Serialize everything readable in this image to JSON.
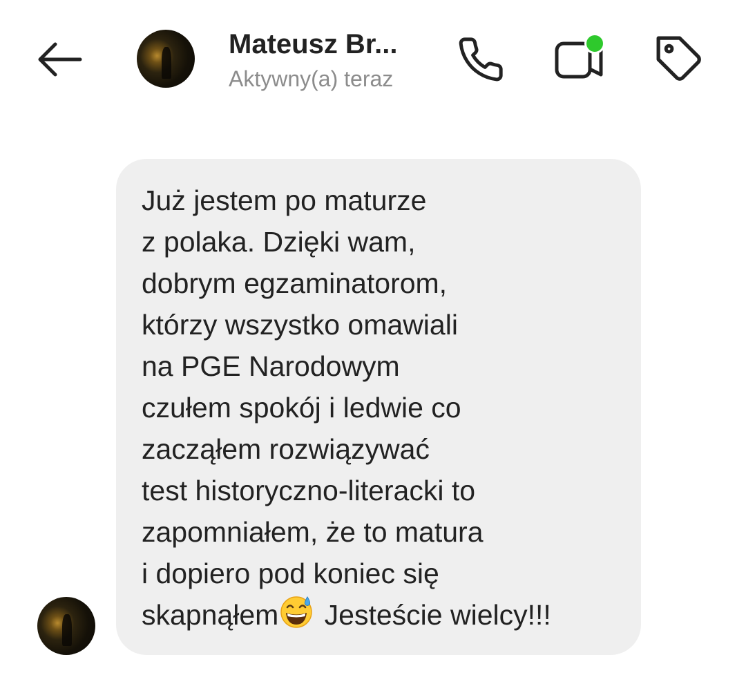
{
  "header": {
    "back_icon": "arrow-left-icon",
    "contact_name": "Mateusz Br...",
    "status": "Aktywny(a) teraz",
    "call_icon": "phone-icon",
    "video_icon": "video-camera-icon",
    "tag_icon": "tag-icon",
    "online_color": "#2ec92c"
  },
  "message": {
    "bubble_color": "#efefef",
    "lines": [
      "Już jestem po maturze",
      "z polaka. Dzięki wam,",
      "dobrym egzaminatorom,",
      "którzy wszystko omawiali",
      "na PGE Narodowym",
      "czułem spokój i ledwie co",
      "zacząłem rozwiązywać",
      "test historyczno-literacki to",
      "zapomniałem, że to matura",
      "i dopiero pod koniec się"
    ],
    "last_line_before_emoji": "skapnąłem",
    "emoji": "grinning-face-with-sweat-emoji",
    "last_line_after_emoji": " Jesteście wielcy!!!"
  }
}
